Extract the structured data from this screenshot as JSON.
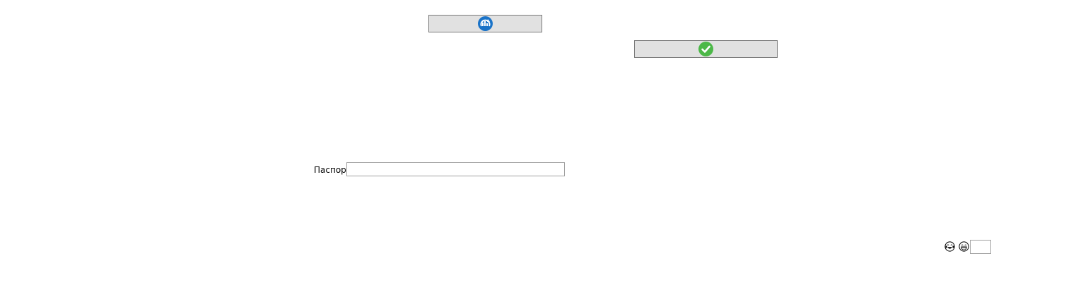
{
  "buttons": {
    "refresh": {
      "icon": "refresh-icon",
      "color": "#1a73c8"
    },
    "confirm": {
      "icon": "checkmark-icon",
      "color": "#4cb848"
    }
  },
  "passport": {
    "label": "Паспорт",
    "value": ""
  },
  "emojis": [
    {
      "icon": "tears-of-joy-emoji-icon"
    },
    {
      "icon": "grinning-emoji-icon"
    }
  ],
  "small_field": {
    "value": ""
  }
}
